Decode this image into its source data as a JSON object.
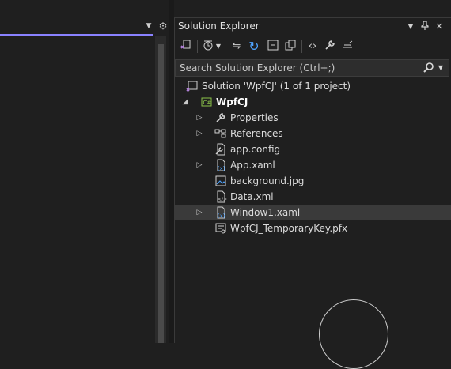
{
  "editor": {
    "dropdown_icon": "chevron-down-icon",
    "settings_icon": "gear-icon",
    "accent_color": "#8a82ff"
  },
  "solution_explorer": {
    "title": "Solution Explorer",
    "title_buttons": [
      "window-position-icon",
      "pin-icon",
      "close-icon"
    ],
    "toolbar_icons": [
      "switch-views-icon",
      "pending-changes-filter-icon",
      "sync-with-document-icon",
      "refresh-icon",
      "collapse-all-icon",
      "show-all-files-icon",
      "view-code-icon",
      "properties-icon",
      "preview-icon"
    ],
    "search": {
      "placeholder": "Search Solution Explorer (Ctrl+;)",
      "value": ""
    },
    "tree": {
      "solution_label": "Solution 'WpfCJ' (1 of 1 project)",
      "project_label": "WpfCJ",
      "items": [
        {
          "label": "Properties",
          "icon": "wrench-icon"
        },
        {
          "label": "References",
          "icon": "references-icon"
        },
        {
          "label": "app.config",
          "icon": "config-file-icon"
        },
        {
          "label": "App.xaml",
          "icon": "xaml-file-icon"
        },
        {
          "label": "background.jpg",
          "icon": "image-file-icon"
        },
        {
          "label": "Data.xml",
          "icon": "xml-file-icon"
        },
        {
          "label": "Window1.xaml",
          "icon": "xaml-file-icon"
        },
        {
          "label": "WpfCJ_TemporaryKey.pfx",
          "icon": "certificate-file-icon"
        }
      ]
    }
  }
}
